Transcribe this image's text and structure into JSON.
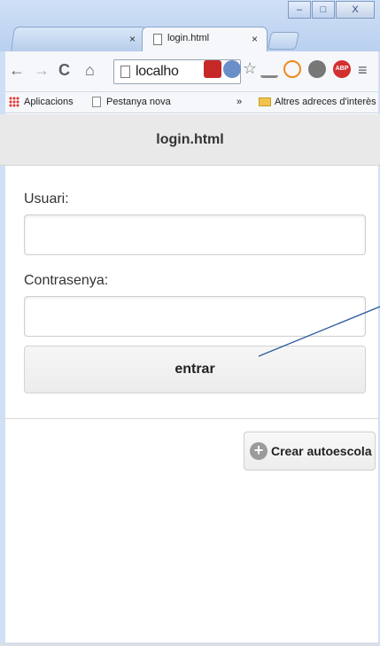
{
  "browser": {
    "tabs": [
      {
        "title": "",
        "close": "×"
      },
      {
        "title": "login.html",
        "close": "×"
      }
    ],
    "window_buttons": [
      "–",
      "□",
      "X"
    ],
    "url": "localho",
    "nav": {
      "back": "←",
      "forward": "→",
      "reload": "C",
      "home": "⌂",
      "star": "☆",
      "menu": "≡"
    },
    "bookmarks": [
      {
        "label": "Aplicacions",
        "icon": "apps-icon"
      },
      {
        "label": "Pestanya nova",
        "icon": "page-icon"
      }
    ],
    "bookmarks_overflow": "»",
    "other_bookmarks": "Altres adreces d'interès",
    "extension_badge": "ABP",
    "colors": {
      "chrome": "#cfe0f6",
      "toolbar": "#f5f7fa"
    }
  },
  "page": {
    "header_title": "login.html",
    "user_label": "Usuari:",
    "user_value": "",
    "password_label": "Contrasenya:",
    "password_value": "",
    "submit_label": "entrar",
    "create_label": "Crear autoescola",
    "create_icon": "plus-circle-icon",
    "colors": {
      "header_bg": "#e9e9e9",
      "button_bg": "#f2f2f2",
      "annotation_line": "#2c5b9c"
    }
  }
}
